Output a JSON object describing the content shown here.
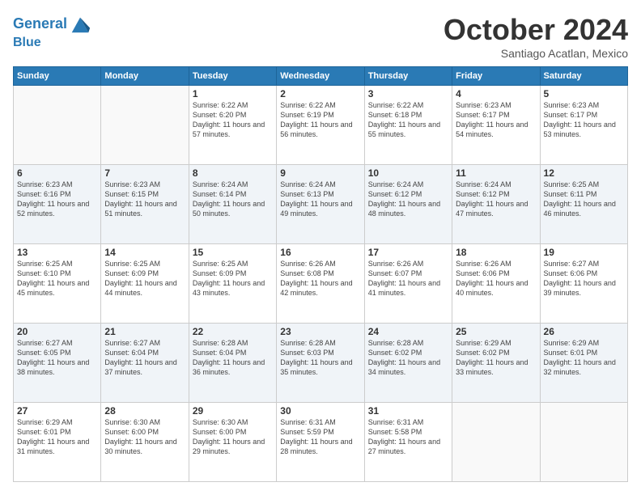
{
  "header": {
    "logo_line1": "General",
    "logo_line2": "Blue",
    "title": "October 2024",
    "subtitle": "Santiago Acatlan, Mexico"
  },
  "weekdays": [
    "Sunday",
    "Monday",
    "Tuesday",
    "Wednesday",
    "Thursday",
    "Friday",
    "Saturday"
  ],
  "weeks": [
    [
      {
        "day": "",
        "info": ""
      },
      {
        "day": "",
        "info": ""
      },
      {
        "day": "1",
        "info": "Sunrise: 6:22 AM\nSunset: 6:20 PM\nDaylight: 11 hours and 57 minutes."
      },
      {
        "day": "2",
        "info": "Sunrise: 6:22 AM\nSunset: 6:19 PM\nDaylight: 11 hours and 56 minutes."
      },
      {
        "day": "3",
        "info": "Sunrise: 6:22 AM\nSunset: 6:18 PM\nDaylight: 11 hours and 55 minutes."
      },
      {
        "day": "4",
        "info": "Sunrise: 6:23 AM\nSunset: 6:17 PM\nDaylight: 11 hours and 54 minutes."
      },
      {
        "day": "5",
        "info": "Sunrise: 6:23 AM\nSunset: 6:17 PM\nDaylight: 11 hours and 53 minutes."
      }
    ],
    [
      {
        "day": "6",
        "info": "Sunrise: 6:23 AM\nSunset: 6:16 PM\nDaylight: 11 hours and 52 minutes."
      },
      {
        "day": "7",
        "info": "Sunrise: 6:23 AM\nSunset: 6:15 PM\nDaylight: 11 hours and 51 minutes."
      },
      {
        "day": "8",
        "info": "Sunrise: 6:24 AM\nSunset: 6:14 PM\nDaylight: 11 hours and 50 minutes."
      },
      {
        "day": "9",
        "info": "Sunrise: 6:24 AM\nSunset: 6:13 PM\nDaylight: 11 hours and 49 minutes."
      },
      {
        "day": "10",
        "info": "Sunrise: 6:24 AM\nSunset: 6:12 PM\nDaylight: 11 hours and 48 minutes."
      },
      {
        "day": "11",
        "info": "Sunrise: 6:24 AM\nSunset: 6:12 PM\nDaylight: 11 hours and 47 minutes."
      },
      {
        "day": "12",
        "info": "Sunrise: 6:25 AM\nSunset: 6:11 PM\nDaylight: 11 hours and 46 minutes."
      }
    ],
    [
      {
        "day": "13",
        "info": "Sunrise: 6:25 AM\nSunset: 6:10 PM\nDaylight: 11 hours and 45 minutes."
      },
      {
        "day": "14",
        "info": "Sunrise: 6:25 AM\nSunset: 6:09 PM\nDaylight: 11 hours and 44 minutes."
      },
      {
        "day": "15",
        "info": "Sunrise: 6:25 AM\nSunset: 6:09 PM\nDaylight: 11 hours and 43 minutes."
      },
      {
        "day": "16",
        "info": "Sunrise: 6:26 AM\nSunset: 6:08 PM\nDaylight: 11 hours and 42 minutes."
      },
      {
        "day": "17",
        "info": "Sunrise: 6:26 AM\nSunset: 6:07 PM\nDaylight: 11 hours and 41 minutes."
      },
      {
        "day": "18",
        "info": "Sunrise: 6:26 AM\nSunset: 6:06 PM\nDaylight: 11 hours and 40 minutes."
      },
      {
        "day": "19",
        "info": "Sunrise: 6:27 AM\nSunset: 6:06 PM\nDaylight: 11 hours and 39 minutes."
      }
    ],
    [
      {
        "day": "20",
        "info": "Sunrise: 6:27 AM\nSunset: 6:05 PM\nDaylight: 11 hours and 38 minutes."
      },
      {
        "day": "21",
        "info": "Sunrise: 6:27 AM\nSunset: 6:04 PM\nDaylight: 11 hours and 37 minutes."
      },
      {
        "day": "22",
        "info": "Sunrise: 6:28 AM\nSunset: 6:04 PM\nDaylight: 11 hours and 36 minutes."
      },
      {
        "day": "23",
        "info": "Sunrise: 6:28 AM\nSunset: 6:03 PM\nDaylight: 11 hours and 35 minutes."
      },
      {
        "day": "24",
        "info": "Sunrise: 6:28 AM\nSunset: 6:02 PM\nDaylight: 11 hours and 34 minutes."
      },
      {
        "day": "25",
        "info": "Sunrise: 6:29 AM\nSunset: 6:02 PM\nDaylight: 11 hours and 33 minutes."
      },
      {
        "day": "26",
        "info": "Sunrise: 6:29 AM\nSunset: 6:01 PM\nDaylight: 11 hours and 32 minutes."
      }
    ],
    [
      {
        "day": "27",
        "info": "Sunrise: 6:29 AM\nSunset: 6:01 PM\nDaylight: 11 hours and 31 minutes."
      },
      {
        "day": "28",
        "info": "Sunrise: 6:30 AM\nSunset: 6:00 PM\nDaylight: 11 hours and 30 minutes."
      },
      {
        "day": "29",
        "info": "Sunrise: 6:30 AM\nSunset: 6:00 PM\nDaylight: 11 hours and 29 minutes."
      },
      {
        "day": "30",
        "info": "Sunrise: 6:31 AM\nSunset: 5:59 PM\nDaylight: 11 hours and 28 minutes."
      },
      {
        "day": "31",
        "info": "Sunrise: 6:31 AM\nSunset: 5:58 PM\nDaylight: 11 hours and 27 minutes."
      },
      {
        "day": "",
        "info": ""
      },
      {
        "day": "",
        "info": ""
      }
    ]
  ]
}
